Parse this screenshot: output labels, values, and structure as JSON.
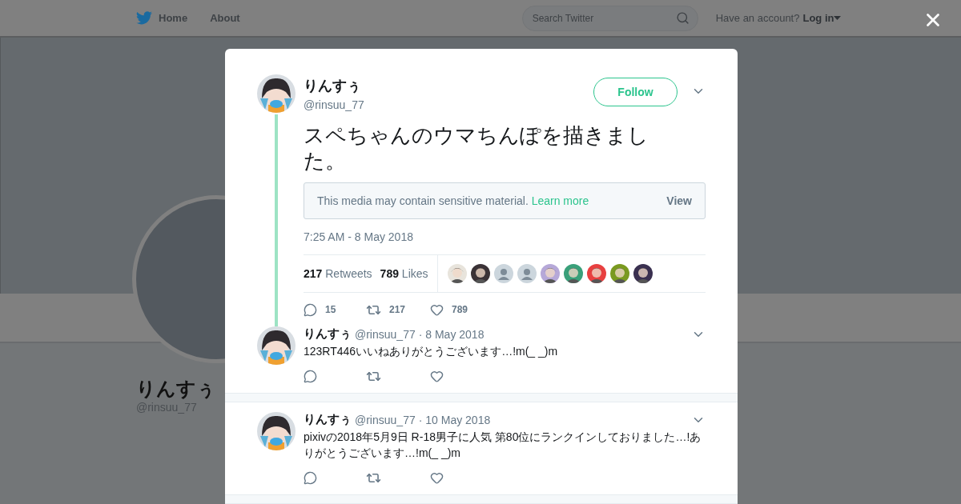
{
  "header": {
    "nav": [
      {
        "label": "Home",
        "selected": false
      },
      {
        "label": "About",
        "selected": false
      }
    ],
    "search": {
      "placeholder": "Search Twitter"
    },
    "account_prompt": "Have an account?",
    "login": "Log in"
  },
  "profile": {
    "name": "りんすぅ",
    "handle": "@rinsuu_77"
  },
  "tweet": {
    "name": "りんすぅ",
    "handle": "@rinsuu_77",
    "follow": "Follow",
    "text": "スペちゃんのウマちんぽを描きました。",
    "notice": {
      "text": "This media may contain sensitive material.",
      "link": "Learn more",
      "button": "View"
    },
    "time": "7:25 AM - 8 May 2018",
    "stats": [
      {
        "count": "217",
        "label": "Retweets"
      },
      {
        "count": "789",
        "label": "Likes"
      }
    ],
    "likers": [
      {
        "kind": "picture",
        "color": "#e8e4dc"
      },
      {
        "kind": "picture",
        "color": "#3a3236"
      },
      {
        "kind": "default",
        "color": "#ccd6dd"
      },
      {
        "kind": "default",
        "color": "#ccd6dd"
      },
      {
        "kind": "picture",
        "color": "#b6a8d8"
      },
      {
        "kind": "picture",
        "color": "#3aa07a"
      },
      {
        "kind": "picture",
        "color": "#e84040"
      },
      {
        "kind": "picture",
        "color": "#7a9a20"
      },
      {
        "kind": "picture",
        "color": "#3a3050"
      }
    ],
    "actions": {
      "replies": "15",
      "retweets": "217",
      "likes": "789"
    }
  },
  "replies": [
    {
      "name": "りんすぅ",
      "handle": "@rinsuu_77",
      "date": "· 8 May 2018",
      "text": "123RT446いいねありがとうございます…!m(_ _)m",
      "threaded": true
    },
    {
      "name": "りんすぅ",
      "handle": "@rinsuu_77",
      "date": "· 10 May 2018",
      "text": "pixivの2018年5月9日 R-18男子に人気 第80位にランクインしておりました…!ありがとうございます…!m(_ _)m",
      "threaded": false
    }
  ]
}
